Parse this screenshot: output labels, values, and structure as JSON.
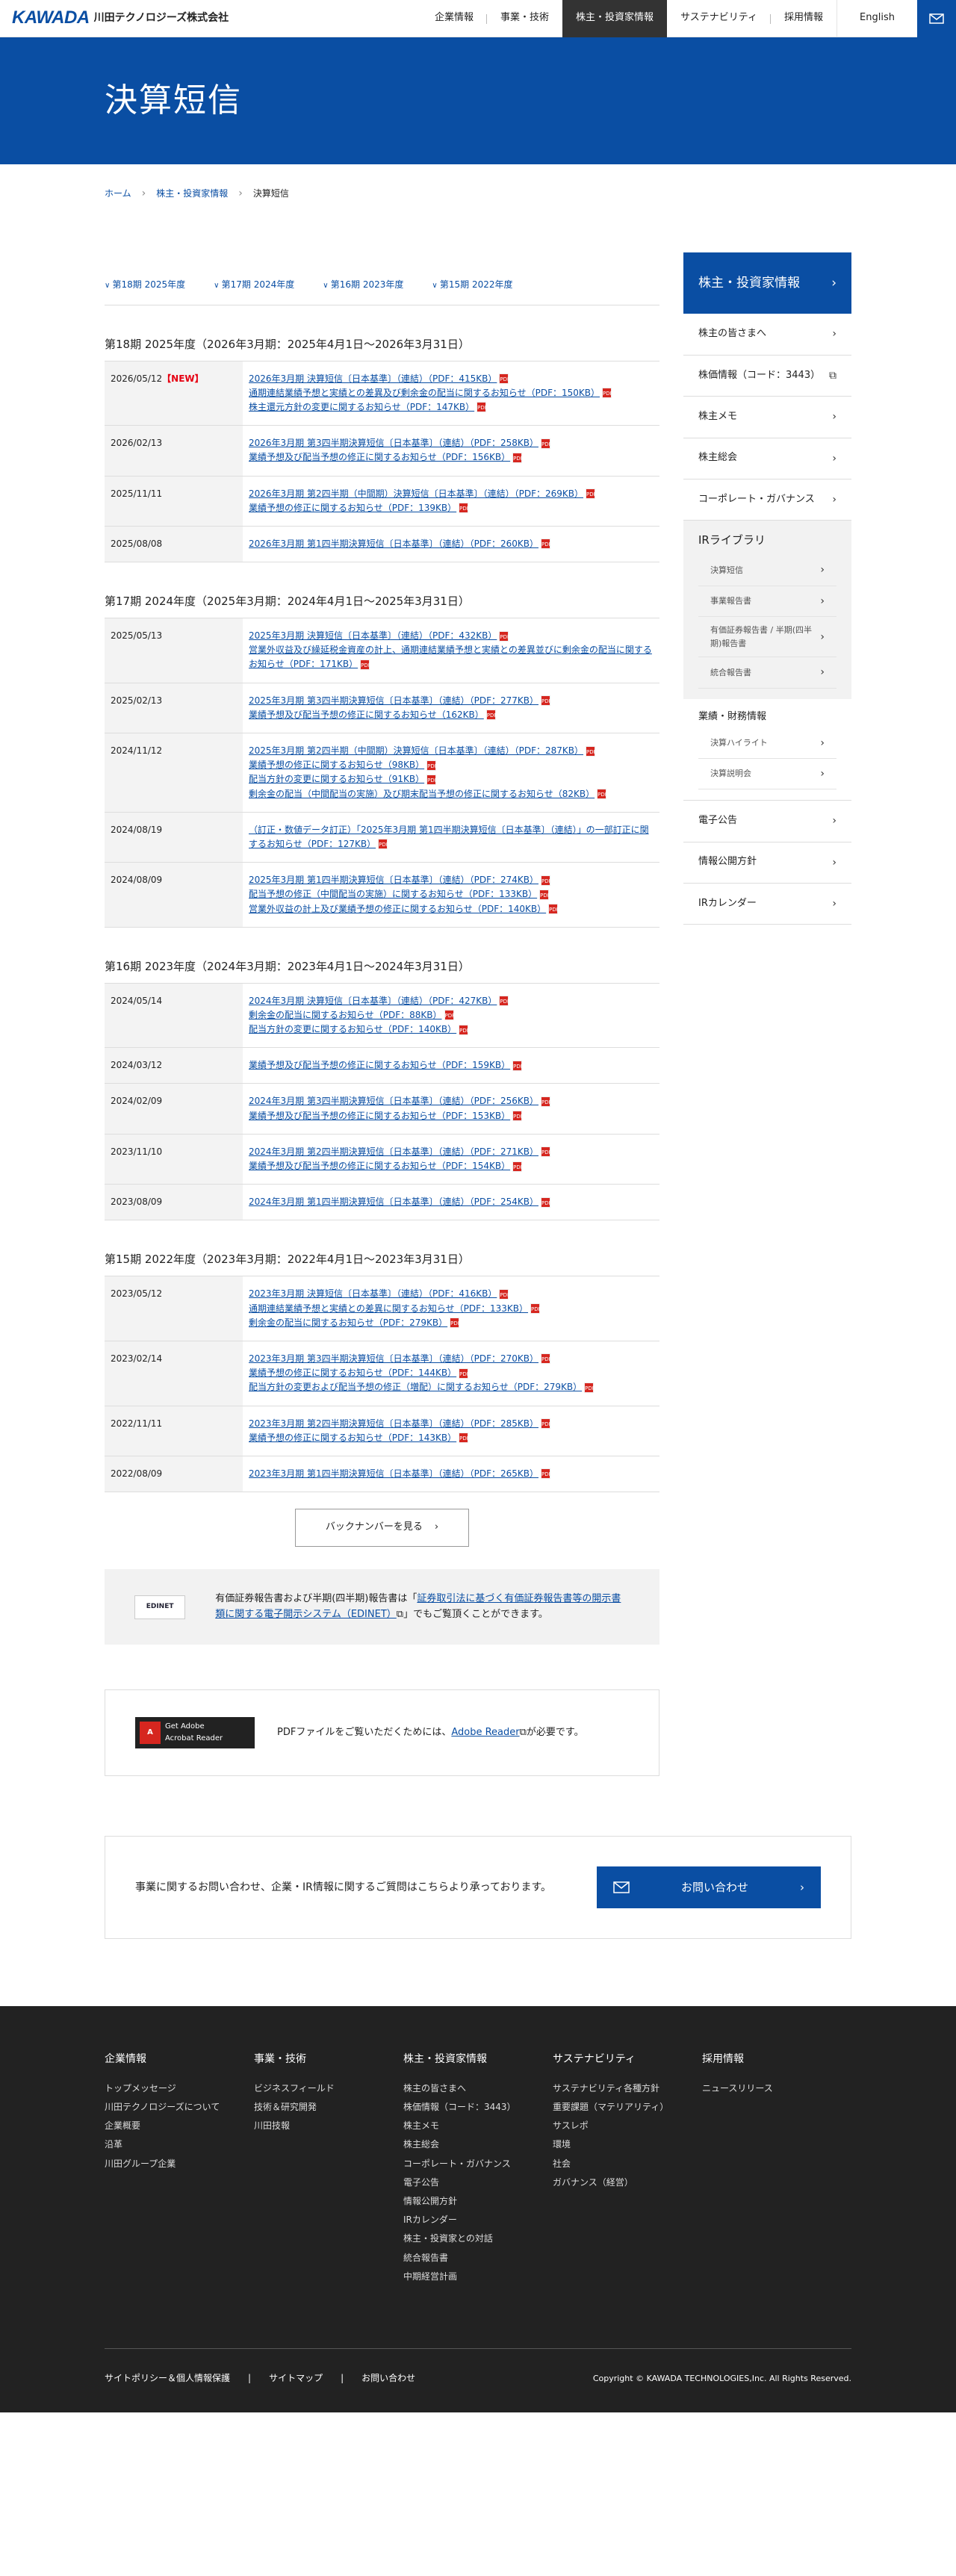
{
  "header": {
    "logo_mark": "KAWADA",
    "company": "川田テクノロジーズ株式会社",
    "nav": [
      {
        "label": "企業情報"
      },
      {
        "label": "事業・技術"
      },
      {
        "label": "株主・投資家情報"
      },
      {
        "label": "サステナビリティ"
      },
      {
        "label": "採用情報"
      }
    ],
    "english": "English"
  },
  "hero": {
    "title": "決算短信"
  },
  "breadcrumb": {
    "home": "ホーム",
    "parent": "株主・投資家情報",
    "current": "決算短信"
  },
  "tabs": [
    "第18期 2025年度",
    "第17期 2024年度",
    "第16期 2023年度",
    "第15期 2022年度"
  ],
  "years": [
    {
      "title": "第18期 2025年度（2026年3月期：2025年4月1日～2026年3月31日）",
      "rows": [
        {
          "date": "2026/05/12",
          "new": "【NEW】",
          "docs": [
            "2026年3月期 決算短信〔日本基準〕（連結）（PDF：415KB）",
            "通期連結業績予想と実績との差異及び剰余金の配当に関するお知らせ（PDF：150KB）",
            "株主還元方針の変更に関するお知らせ（PDF：147KB）"
          ]
        },
        {
          "date": "2026/02/13",
          "new": "",
          "docs": [
            "2026年3月期 第3四半期決算短信〔日本基準〕（連結）（PDF：258KB）",
            "業績予想及び配当予想の修正に関するお知らせ（PDF：156KB）"
          ]
        },
        {
          "date": "2025/11/11",
          "new": "",
          "docs": [
            "2026年3月期 第2四半期（中間期）決算短信〔日本基準〕（連結）（PDF：269KB）",
            "業績予想の修正に関するお知らせ（PDF：139KB）"
          ]
        },
        {
          "date": "2025/08/08",
          "new": "",
          "docs": [
            "2026年3月期 第1四半期決算短信〔日本基準〕（連結）（PDF：260KB）"
          ]
        }
      ]
    },
    {
      "title": "第17期 2024年度（2025年3月期：2024年4月1日～2025年3月31日）",
      "rows": [
        {
          "date": "2025/05/13",
          "new": "",
          "docs": [
            "2025年3月期 決算短信〔日本基準〕（連結）（PDF：432KB）",
            "営業外収益及び繰延税金資産の計上、通期連結業績予想と実績との差異並びに剰余金の配当に関するお知らせ（PDF：171KB）"
          ]
        },
        {
          "date": "2025/02/13",
          "new": "",
          "docs": [
            "2025年3月期 第3四半期決算短信〔日本基準〕（連結）（PDF：277KB）",
            "業績予想及び配当予想の修正に関するお知らせ（162KB）"
          ]
        },
        {
          "date": "2024/11/12",
          "new": "",
          "docs": [
            "2025年3月期 第2四半期（中間期）決算短信〔日本基準〕（連結）（PDF：287KB）",
            "業績予想の修正に関するお知らせ（98KB）",
            "配当方針の変更に関するお知らせ（91KB）",
            "剰余金の配当（中間配当の実施）及び期末配当予想の修正に関するお知らせ（82KB）"
          ]
        },
        {
          "date": "2024/08/19",
          "new": "",
          "docs": [
            "（訂正・数値データ訂正）「2025年3月期 第1四半期決算短信〔日本基準〕（連結）」の一部訂正に関するお知らせ（PDF：127KB）"
          ]
        },
        {
          "date": "2024/08/09",
          "new": "",
          "docs": [
            "2025年3月期 第1四半期決算短信〔日本基準〕（連結）（PDF：274KB）",
            "配当予想の修正（中間配当の実施）に関するお知らせ（PDF：133KB）",
            "営業外収益の計上及び業績予想の修正に関するお知らせ（PDF：140KB）"
          ]
        }
      ]
    },
    {
      "title": "第16期 2023年度（2024年3月期：2023年4月1日～2024年3月31日）",
      "rows": [
        {
          "date": "2024/05/14",
          "new": "",
          "docs": [
            "2024年3月期 決算短信〔日本基準〕（連結）（PDF：427KB）",
            "剰余金の配当に関するお知らせ（PDF：88KB）",
            "配当方針の変更に関するお知らせ（PDF：140KB）"
          ]
        },
        {
          "date": "2024/03/12",
          "new": "",
          "docs": [
            "業績予想及び配当予想の修正に関するお知らせ（PDF：159KB）"
          ]
        },
        {
          "date": "2024/02/09",
          "new": "",
          "docs": [
            "2024年3月期 第3四半期決算短信〔日本基準〕（連結）（PDF：256KB）",
            "業績予想及び配当予想の修正に関するお知らせ（PDF：153KB）"
          ]
        },
        {
          "date": "2023/11/10",
          "new": "",
          "docs": [
            "2024年3月期 第2四半期決算短信〔日本基準〕（連結）（PDF：271KB）",
            "業績予想及び配当予想の修正に関するお知らせ（PDF：154KB）"
          ]
        },
        {
          "date": "2023/08/09",
          "new": "",
          "docs": [
            "2024年3月期 第1四半期決算短信〔日本基準〕（連結）（PDF：254KB）"
          ]
        }
      ]
    },
    {
      "title": "第15期 2022年度（2023年3月期：2022年4月1日～2023年3月31日）",
      "rows": [
        {
          "date": "2023/05/12",
          "new": "",
          "docs": [
            "2023年3月期 決算短信〔日本基準〕（連結）（PDF：416KB）",
            "通期連結業績予想と実績との差異に関するお知らせ（PDF：133KB）",
            "剰余金の配当に関するお知らせ（PDF：279KB）"
          ]
        },
        {
          "date": "2023/02/14",
          "new": "",
          "docs": [
            "2023年3月期 第3四半期決算短信〔日本基準〕（連結）（PDF：270KB）",
            "業績予想の修正に関するお知らせ（PDF：144KB）",
            "配当方針の変更および配当予想の修正（増配）に関するお知らせ（PDF：279KB）"
          ]
        },
        {
          "date": "2022/11/11",
          "new": "",
          "docs": [
            "2023年3月期 第2四半期決算短信〔日本基準〕（連結）（PDF：285KB）",
            "業績予想の修正に関するお知らせ（PDF：143KB）"
          ]
        },
        {
          "date": "2022/08/09",
          "new": "",
          "docs": [
            "2023年3月期 第1四半期決算短信〔日本基準〕（連結）（PDF：265KB）"
          ]
        }
      ]
    }
  ],
  "more_button": "バックナンバーを見る",
  "edinet": {
    "badge": "EDINET",
    "pre": "有価証券報告書および半期(四半期)報告書は「",
    "link": "証券取引法に基づく有価証券報告書等の開示書類に関する電子開示システム（EDINET）",
    "post": "」でもご覧頂くことができます。"
  },
  "acrobat": {
    "badge_line1": "Get Adobe",
    "badge_line2": "Acrobat Reader",
    "pre": "PDFファイルをご覧いただくためには、",
    "link": "Adobe Reader",
    "post": "が必要です。"
  },
  "sidebar": {
    "head": "株主・投資家情報",
    "items": [
      "株主の皆さまへ",
      "株価情報（コード：3443）",
      "株主メモ",
      "株主総会",
      "コーポレート・ガバナンス"
    ],
    "library_title": "IRライブラリ",
    "library": [
      "決算短信",
      "事業報告書",
      "有価証券報告書 / 半期(四半期)報告書",
      "統合報告書"
    ],
    "finance_title": "業績・財務情報",
    "finance": [
      "決算ハイライト",
      "決算説明会"
    ],
    "tail": [
      "電子公告",
      "情報公開方針",
      "IRカレンダー"
    ]
  },
  "contact": {
    "text": "事業に関するお問い合わせ、企業・IR情報に関するご質問はこちらより承っております。",
    "button": "お問い合わせ"
  },
  "footer": {
    "cols": [
      {
        "title": "企業情報",
        "links": [
          "トップメッセージ",
          "川田テクノロジーズについて",
          "企業概要",
          "沿革",
          "川田グループ企業"
        ]
      },
      {
        "title": "事業・技術",
        "links": [
          "ビジネスフィールド",
          "技術＆研究開発",
          "川田技報"
        ]
      },
      {
        "title": "株主・投資家情報",
        "links": [
          "株主の皆さまへ",
          "株価情報（コード：3443）",
          "株主メモ",
          "株主総会",
          "コーポレート・ガバナンス",
          "電子公告",
          "情報公開方針",
          "IRカレンダー",
          "株主・投資家との対話",
          "統合報告書",
          "中期経営計画"
        ]
      },
      {
        "title": "サステナビリティ",
        "links": [
          "サステナビリティ各種方針",
          "重要課題（マテリアリティ）",
          "サスレポ",
          "環境",
          "社会",
          "ガバナンス（経営）"
        ]
      },
      {
        "title": "採用情報",
        "links": [
          "ニュースリリース"
        ]
      }
    ],
    "bottom_links": [
      "サイトポリシー＆個人情報保護",
      "サイトマップ",
      "お問い合わせ"
    ],
    "copyright": "Copyright © KAWADA TECHNOLOGIES,Inc. All Rights Reserved."
  }
}
